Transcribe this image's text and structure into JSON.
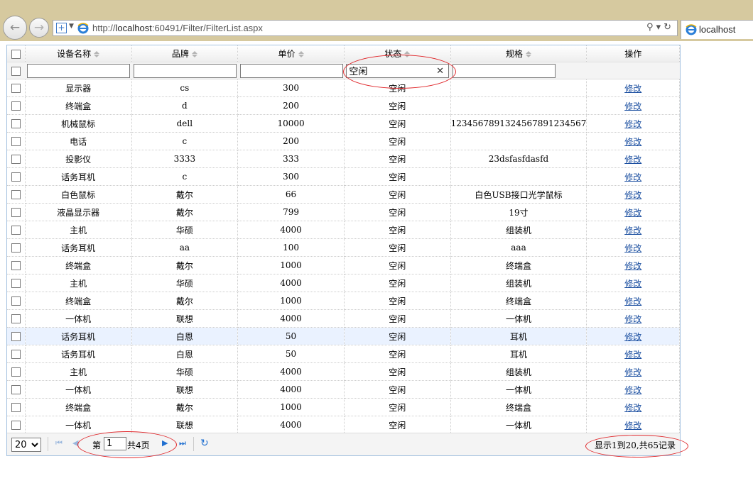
{
  "browser": {
    "url_prefix": "http://",
    "url_host": "localhost",
    "url_rest": ":60491/Filter/FilterList.aspx",
    "tab_title": "localhost"
  },
  "grid": {
    "columns": [
      "设备名称",
      "品牌",
      "单价",
      "状态",
      "规格",
      "操作"
    ],
    "filters": [
      "",
      "",
      "",
      "空闲",
      ""
    ],
    "rows": [
      [
        "显示器",
        "cs",
        "300",
        "空闲",
        ""
      ],
      [
        "终端盒",
        "d",
        "200",
        "空闲",
        ""
      ],
      [
        "机械鼠标",
        "dell",
        "10000",
        "空闲",
        "1234567891324567891234567"
      ],
      [
        "电话",
        "c",
        "200",
        "空闲",
        ""
      ],
      [
        "投影仪",
        "3333",
        "333",
        "空闲",
        "23dsfasfdasfd"
      ],
      [
        "话务耳机",
        "c",
        "300",
        "空闲",
        ""
      ],
      [
        "白色鼠标",
        "戴尔",
        "66",
        "空闲",
        "白色USB接口光学鼠标"
      ],
      [
        "液晶显示器",
        "戴尔",
        "799",
        "空闲",
        "19寸"
      ],
      [
        "主机",
        "华硕",
        "4000",
        "空闲",
        "组装机"
      ],
      [
        "话务耳机",
        "aa",
        "100",
        "空闲",
        "aaa"
      ],
      [
        "终端盒",
        "戴尔",
        "1000",
        "空闲",
        "终端盒"
      ],
      [
        "主机",
        "华硕",
        "4000",
        "空闲",
        "组装机"
      ],
      [
        "终端盒",
        "戴尔",
        "1000",
        "空闲",
        "终端盒"
      ],
      [
        "一体机",
        "联想",
        "4000",
        "空闲",
        "一体机"
      ],
      [
        "话务耳机",
        "白恩",
        "50",
        "空闲",
        "耳机"
      ],
      [
        "话务耳机",
        "白恩",
        "50",
        "空闲",
        "耳机"
      ],
      [
        "主机",
        "华硕",
        "4000",
        "空闲",
        "组装机"
      ],
      [
        "一体机",
        "联想",
        "4000",
        "空闲",
        "一体机"
      ],
      [
        "终端盒",
        "戴尔",
        "1000",
        "空闲",
        "终端盒"
      ],
      [
        "一体机",
        "联想",
        "4000",
        "空闲",
        "一体机"
      ]
    ],
    "action_label": "修改",
    "selected_row": 14
  },
  "pager": {
    "page_size": "20",
    "page_prefix": "第",
    "page_number": "1",
    "page_suffix": "共4页",
    "info": "显示1到20,共65记录"
  },
  "colors": {
    "annotation_ring": "#e0282c",
    "link": "#1a4ea0",
    "grid_border": "#a5c2e0"
  }
}
